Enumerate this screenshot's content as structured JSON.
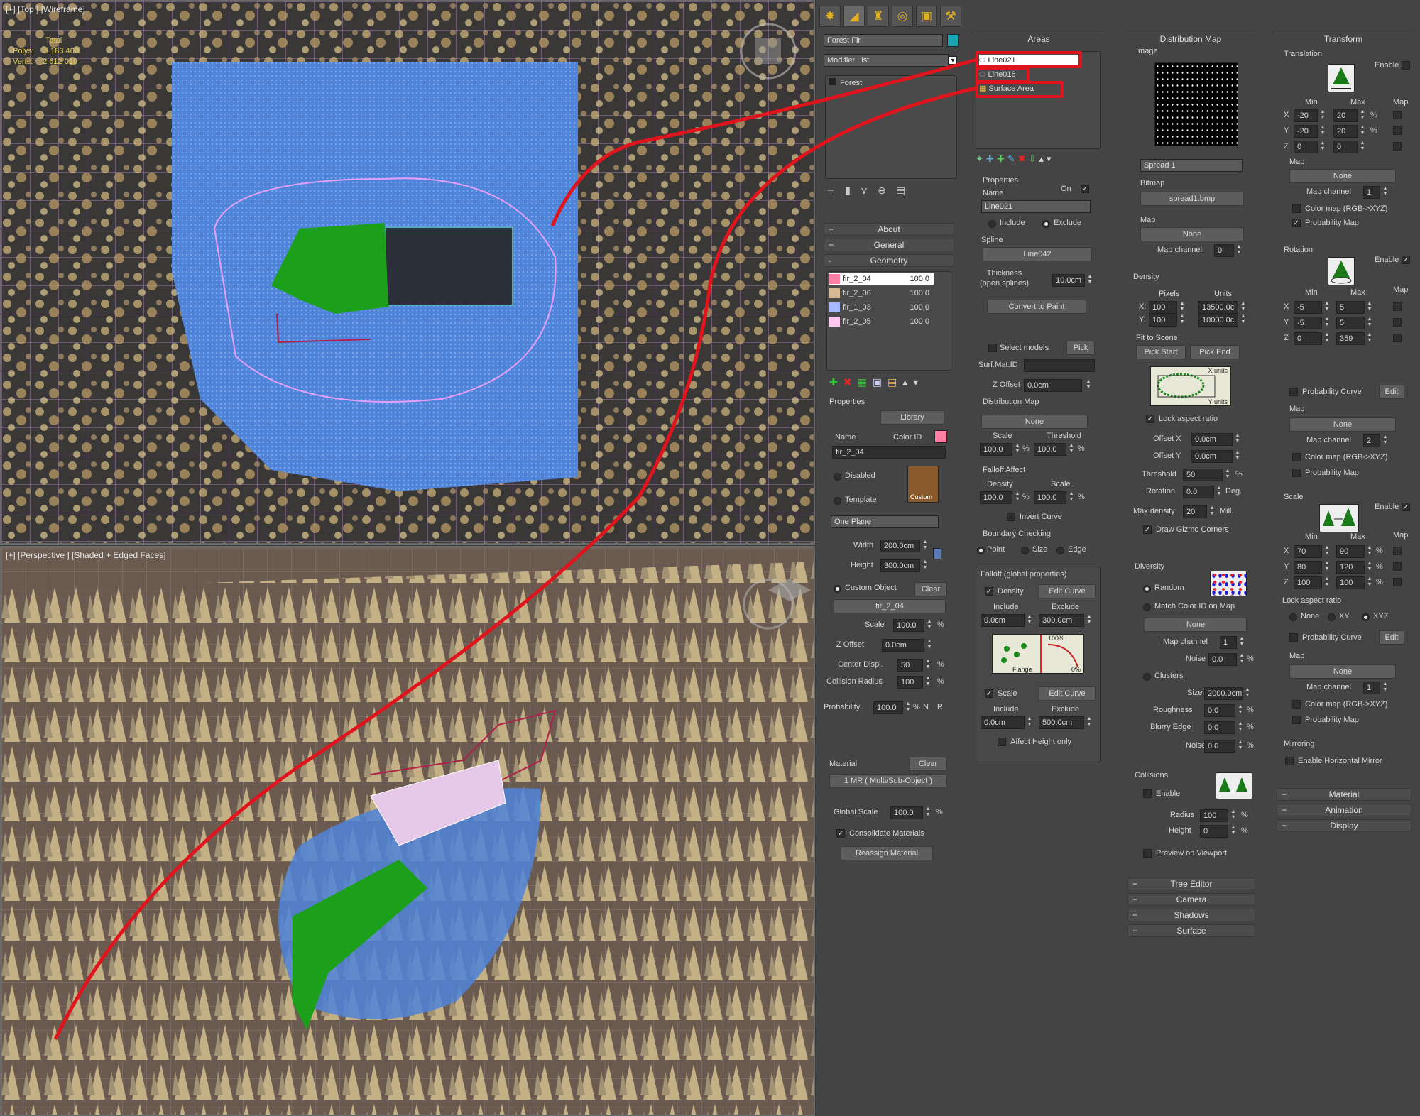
{
  "viewports": {
    "top": {
      "label": "[+] [Top ] [Wireframe]",
      "stats": {
        "total": "Total",
        "polys_label": "Polys:",
        "polys": "5 183 460",
        "verts_label": "Verts:",
        "verts": "2 612 010"
      }
    },
    "persp": {
      "label": "[+] [Perspective ] [Shaded + Edged Faces]"
    }
  },
  "colors": {
    "accent_red": "#e0141c",
    "selection_blue": "#4a8cff",
    "foliage": "#c8b07a",
    "ground": "#6a5a4f",
    "green_patch": "#1ca01c",
    "object_color": "#1aa3b0",
    "color_id": "#ff7fa5"
  },
  "command_tabs": [
    "create-icon",
    "modify-icon",
    "hierarchy-icon",
    "motion-icon",
    "display-icon",
    "utilities-icon"
  ],
  "modify": {
    "object_name": "Forest Fir",
    "modifier_list": "Modifier List",
    "stack_item": "Forest",
    "rollouts": {
      "about": "About",
      "general": "General",
      "geometry": "Geometry"
    },
    "geometry_items": [
      {
        "name": "fir_2_04",
        "value": "100.0",
        "color": "#ff7fa5"
      },
      {
        "name": "fir_2_06",
        "value": "100.0",
        "color": "#d8b890"
      },
      {
        "name": "fir_1_03",
        "value": "100.0",
        "color": "#a8b8ff"
      },
      {
        "name": "fir_2_05",
        "value": "100.0",
        "color": "#ffc8f0"
      }
    ],
    "properties": {
      "title": "Properties",
      "library": "Library",
      "name_label": "Name",
      "color_id_label": "Color ID",
      "name": "fir_2_04",
      "disabled": "Disabled",
      "template": "Template",
      "custom_label": "Custom",
      "template_select": "One Plane",
      "width_label": "Width",
      "width": "200.0cm",
      "height_label": "Height",
      "height": "300.0cm",
      "custom_object": "Custom Object",
      "clear": "Clear",
      "custom_object_value": "fir_2_04",
      "scale_label": "Scale",
      "scale": "100.0",
      "z_offset_label": "Z Offset",
      "z_offset": "0.0cm",
      "center_displ_label": "Center Displ.",
      "center_displ": "50",
      "collision_label": "Collision Radius",
      "collision": "100",
      "probability_label": "Probability",
      "probability": "100.0",
      "n_label": "N",
      "r_label": "R",
      "material_label": "Material",
      "material_clear": "Clear",
      "material_value": "1 MR ( Multi/Sub-Object )",
      "global_scale_label": "Global Scale",
      "global_scale": "100.0",
      "consolidate": "Consolidate Materials",
      "reassign": "Reassign Material"
    }
  },
  "areas": {
    "title": "Areas",
    "items": [
      "Line021",
      "Line016",
      "Surface Area"
    ],
    "properties_title": "Properties",
    "on_label": "On",
    "name_label": "Name",
    "name": "Line021",
    "include": "Include",
    "exclude": "Exclude",
    "spline_label": "Spline",
    "spline": "Line042",
    "thickness_label": "Thickness\n(open splines)",
    "thickness": "10.0cm",
    "convert": "Convert to Paint",
    "select_models": "Select models",
    "pick": "Pick",
    "surf_mat_label": "Surf.Mat.ID",
    "z_offset_label": "Z Offset",
    "z_offset": "0.0cm",
    "dist_map_title": "Distribution Map",
    "dist_map_value": "None",
    "scale_label": "Scale",
    "threshold_label": "Threshold",
    "scale": "100.0",
    "threshold": "100.0",
    "falloff_affect": "Falloff Affect",
    "density_label": "Density",
    "fa_scale_label": "Scale",
    "fa_density": "100.0",
    "fa_scale": "100.0",
    "invert_curve": "Invert Curve",
    "boundary_title": "Boundary Checking",
    "point": "Point",
    "size": "Size",
    "edge": "Edge",
    "falloff_global": "Falloff (global properties)",
    "density_chk": "Density",
    "edit_curve": "Edit Curve",
    "include_lbl": "Include",
    "exclude_lbl": "Exclude",
    "fd_include": "0.0cm",
    "fd_exclude": "300.0cm",
    "flange": "Flange",
    "pct100": "100%",
    "pct0": "0%",
    "scale_chk": "Scale",
    "fs_include": "0.0cm",
    "fs_exclude": "500.0cm",
    "affect_height": "Affect Height only"
  },
  "distribution": {
    "title": "Distribution Map",
    "image_label": "Image",
    "spread_select": "Spread 1",
    "bitmap_label": "Bitmap",
    "bitmap": "spread1.bmp",
    "map_label": "Map",
    "map_value": "None",
    "map_channel_label": "Map channel",
    "map_channel": "0",
    "density_title": "Density",
    "pixels": "Pixels",
    "units": "Units",
    "x_label": "X:",
    "y_label": "Y:",
    "px": "100",
    "py": "100",
    "ux": "13500.0c",
    "uy": "10000.0c",
    "fit_label": "Fit to Scene",
    "pick_start": "Pick Start",
    "pick_end": "Pick End",
    "x_units": "X units",
    "y_units": "Y units",
    "lock_aspect": "Lock aspect ratio",
    "offset_x_label": "Offset X",
    "offset_x": "0.0cm",
    "offset_y_label": "Offset Y",
    "offset_y": "0.0cm",
    "threshold_label": "Threshold",
    "threshold": "50",
    "rotation_label": "Rotation",
    "rotation": "0.0",
    "deg": "Deg.",
    "max_density_label": "Max density",
    "max_density": "20",
    "mill": "Mill.",
    "draw_gizmo": "Draw Gizmo Corners",
    "diversity_title": "Diversity",
    "random": "Random",
    "match_color": "Match Color ID on Map",
    "match_value": "None",
    "div_map_channel": "1",
    "noise_label": "Noise",
    "noise": "0.0",
    "clusters": "Clusters",
    "size_label": "Size",
    "size": "2000.0cm",
    "roughness_label": "Roughness",
    "roughness": "0.0",
    "blurry_label": "Blurry Edge",
    "blurry": "0.0",
    "noise2": "0.0",
    "collisions_title": "Collisions",
    "enable": "Enable",
    "radius_label": "Radius",
    "radius": "100",
    "height_label": "Height",
    "height": "0",
    "preview": "Preview on Viewport",
    "rollouts": [
      "Tree Editor",
      "Camera",
      "Shadows",
      "Surface"
    ]
  },
  "transform": {
    "title": "Transform",
    "translation": "Translation",
    "enable": "Enable",
    "min": "Min",
    "max": "Max",
    "map": "Map",
    "t": {
      "x": [
        "-20",
        "20"
      ],
      "y": [
        "-20",
        "20"
      ],
      "z": [
        "0",
        "0"
      ]
    },
    "map_label": "Map",
    "none": "None",
    "map_channel_label": "Map channel",
    "map_channel": "1",
    "color_map": "Color map (RGB->XYZ)",
    "prob_map": "Probability Map",
    "rotation": "Rotation",
    "r": {
      "x": [
        "-5",
        "5"
      ],
      "y": [
        "-5",
        "5"
      ],
      "z": [
        "0",
        "359"
      ]
    },
    "prob_curve": "Probability Curve",
    "edit": "Edit",
    "r_map_channel": "2",
    "scale": "Scale",
    "s": {
      "x": [
        "70",
        "90"
      ],
      "y": [
        "80",
        "120"
      ],
      "z": [
        "100",
        "100"
      ]
    },
    "lock_aspect": "Lock aspect ratio",
    "none_r": "None",
    "xy": "XY",
    "xyz": "XYZ",
    "s_map_channel": "1",
    "mirroring": "Mirroring",
    "mirror": "Enable Horizontal Mirror",
    "rollouts": [
      "Material",
      "Animation",
      "Display"
    ]
  }
}
